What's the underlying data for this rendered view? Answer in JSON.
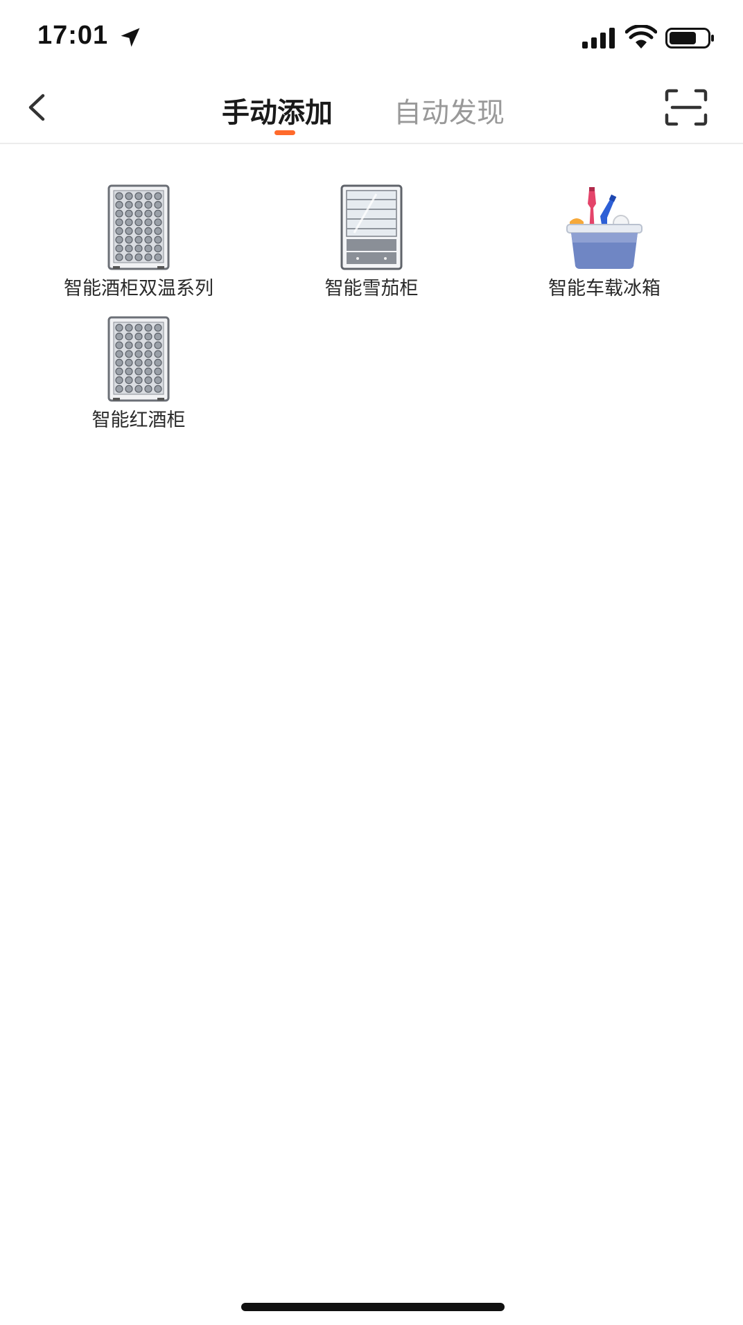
{
  "status_bar": {
    "time": "17:01",
    "icons": [
      "location-arrow-icon",
      "cellular-signal-icon",
      "wifi-icon",
      "battery-icon"
    ]
  },
  "nav": {
    "tabs": [
      {
        "label": "手动添加",
        "active": true
      },
      {
        "label": "自动发现",
        "active": false
      }
    ],
    "accent_color": "#ff6a2b",
    "back_icon": "chevron-left-icon",
    "scan_icon": "scan-icon"
  },
  "devices": [
    {
      "label": "智能酒柜双温系列",
      "icon": "wine-cabinet-icon"
    },
    {
      "label": "智能雪茄柜",
      "icon": "cigar-cabinet-icon"
    },
    {
      "label": "智能车载冰箱",
      "icon": "car-cooler-icon"
    },
    {
      "label": "智能红酒柜",
      "icon": "wine-cabinet-icon"
    }
  ]
}
